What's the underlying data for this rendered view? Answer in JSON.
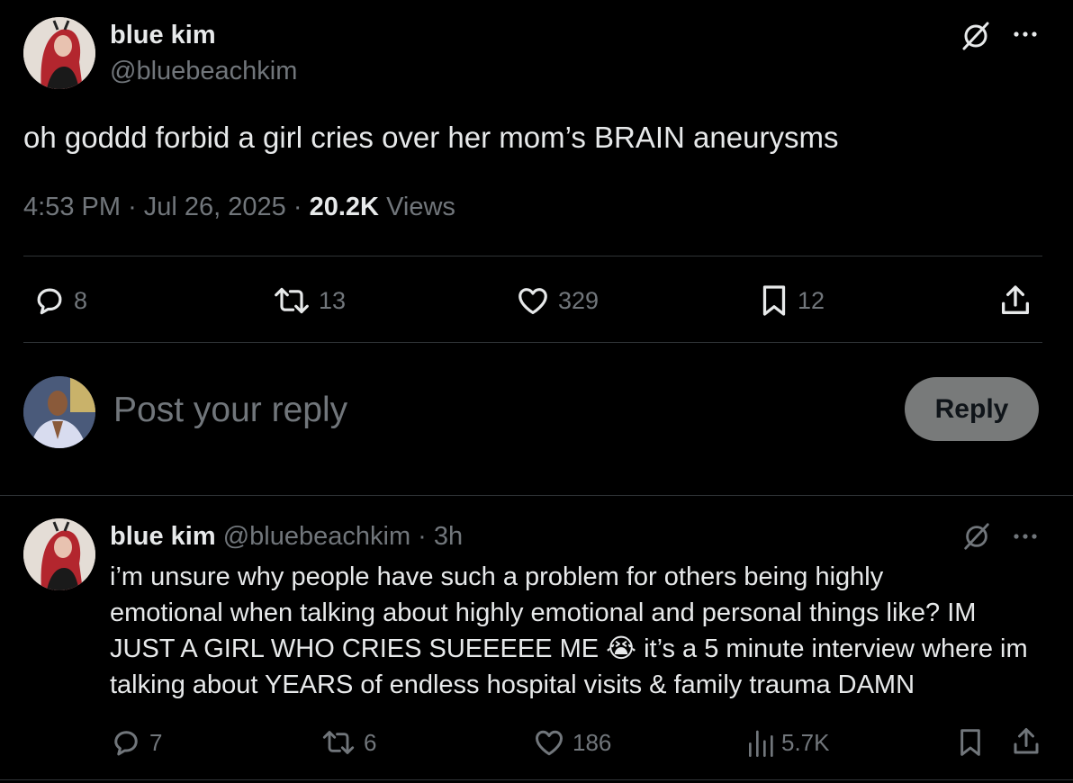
{
  "main_tweet": {
    "author_name": "blue kim",
    "author_handle": "@bluebeachkim",
    "text": "oh goddd forbid a girl cries over her mom’s BRAIN aneurysms",
    "time": "4:53 PM",
    "separator": "·",
    "date": "Jul 26, 2025",
    "views_count": "20.2K",
    "views_label": "Views",
    "stats": {
      "replies": "8",
      "reposts": "13",
      "likes": "329",
      "bookmarks": "12"
    }
  },
  "reply_composer": {
    "placeholder": "Post your reply",
    "button_label": "Reply"
  },
  "reply_tweet": {
    "author_name": "blue kim",
    "author_handle": "@bluebeachkim",
    "meta": "· 3h",
    "text_lines": [
      "i’m unsure why people have such a problem for others being highly",
      "emotional when talking about highly emotional and personal things like? IM",
      "JUST A GIRL WHO CRIES SUEEEEE ME 😭 it’s a 5 minute interview where im",
      "talking about YEARS of endless hospital visits & family trauma DAMN"
    ],
    "stats": {
      "replies": "7",
      "reposts": "6",
      "likes": "186",
      "views": "5.7K"
    }
  },
  "icons": {
    "grok": "grok-slash-icon",
    "more": "more-dots-icon",
    "reply": "speech-bubble-icon",
    "repost": "repost-arrows-icon",
    "like": "heart-icon",
    "bookmark": "bookmark-icon",
    "share": "share-upload-icon",
    "views": "bar-chart-icon"
  },
  "colors": {
    "background": "#000000",
    "text": "#e7e9ea",
    "muted": "#71767b",
    "divider": "#2f3336",
    "reply_button": "#787a7a"
  }
}
